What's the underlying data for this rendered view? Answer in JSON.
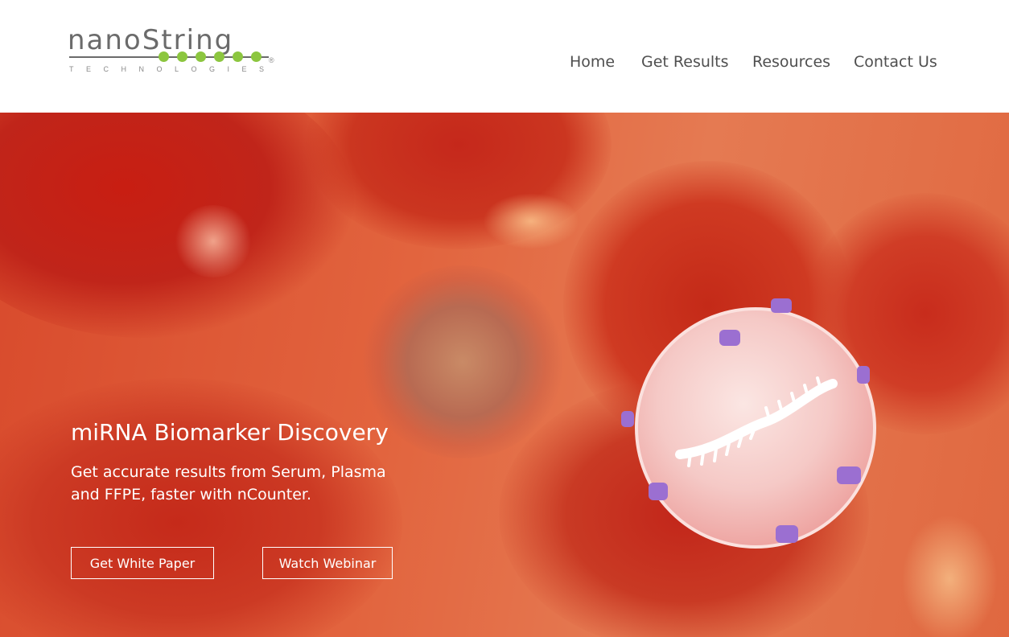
{
  "brand": {
    "wordmark": "nanoString",
    "tagline": "TECHNOLOGIES",
    "registered": "®",
    "dot_color": "#8cc63f",
    "text_color": "#6b6b6b"
  },
  "nav": {
    "items": [
      {
        "label": "Home"
      },
      {
        "label": "Get Results"
      },
      {
        "label": "Resources"
      },
      {
        "label": "Contact Us"
      }
    ]
  },
  "hero": {
    "title": "miRNA Biomarker Discovery",
    "subtitle": "Get accurate results from Serum, Plasma and FFPE, faster with nCounter.",
    "buttons": [
      {
        "label": "Get White Paper"
      },
      {
        "label": "Watch Webinar"
      }
    ],
    "background_image": "red blood cells and exosome containing miRNA",
    "accent_color": "#d84a2c"
  }
}
